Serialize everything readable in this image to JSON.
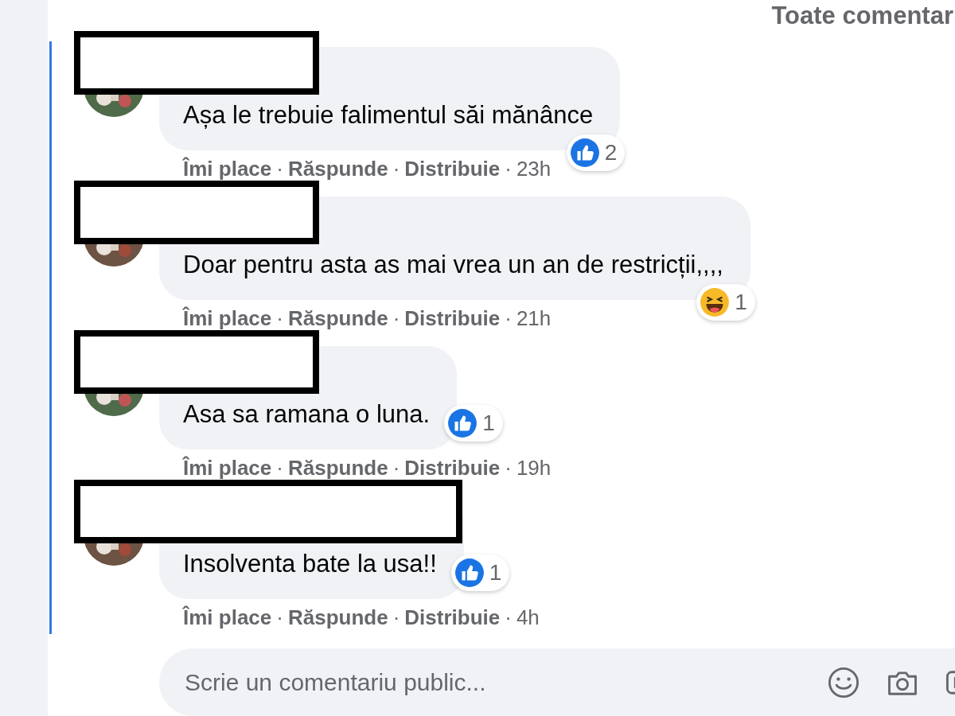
{
  "header": {
    "sort_label": "Toate comentar"
  },
  "comments": [
    {
      "name_redacted": true,
      "text": "Așa le trebuie falimentul săi mănânce",
      "reaction": {
        "kind": "like",
        "inline": false,
        "count": "2"
      },
      "actions": [
        "Îmi place",
        "·",
        "Răspunde",
        "·",
        "Distribuie",
        "·"
      ],
      "time": "23h"
    },
    {
      "name_redacted": true,
      "text": "Doar pentru asta as mai vrea un an de restricții,,,,",
      "reaction": {
        "kind": "haha",
        "inline": false,
        "count": "1"
      },
      "actions": [
        "Îmi place",
        "·",
        "Răspunde",
        "·",
        "Distribuie",
        "·"
      ],
      "time": "21h"
    },
    {
      "name_redacted": true,
      "text": "Asa sa ramana o luna.",
      "reaction": {
        "kind": "like",
        "inline": true,
        "count": "1"
      },
      "actions": [
        "Îmi place",
        "·",
        "Răspunde",
        "·",
        "Distribuie",
        "·"
      ],
      "time": "19h"
    },
    {
      "name_redacted": true,
      "text": "Insolventa bate la usa!!",
      "reaction": {
        "kind": "like",
        "inline": true,
        "count": "1"
      },
      "actions": [
        "Îmi place",
        "·",
        "Răspunde",
        "·",
        "Distribuie",
        "·"
      ],
      "time": "4h"
    }
  ],
  "composer": {
    "placeholder": "Scrie un comentariu public..."
  }
}
